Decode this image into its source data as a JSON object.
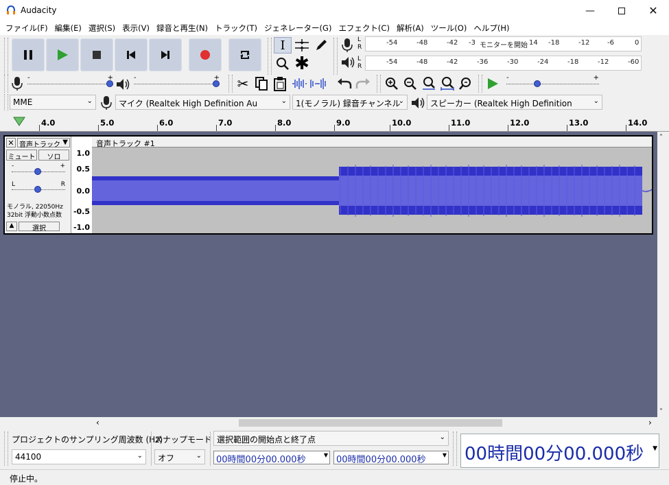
{
  "window": {
    "title": "Audacity"
  },
  "menu": [
    "ファイル(F)",
    "編集(E)",
    "選択(S)",
    "表示(V)",
    "録音と再生(N)",
    "トラック(T)",
    "ジェネレーター(G)",
    "エフェクト(C)",
    "解析(A)",
    "ツール(O)",
    "ヘルプ(H)"
  ],
  "meters": {
    "record_scale": [
      "-54",
      "-48",
      "-42",
      "-3",
      "モニターを開始",
      "14",
      "-18",
      "-12",
      "-6",
      "0"
    ],
    "play_scale": [
      "-54",
      "-48",
      "-42",
      "-36",
      "-30",
      "-24",
      "-18",
      "-12",
      "-6",
      "0"
    ],
    "lr": [
      "L",
      "R"
    ]
  },
  "device": {
    "host": "MME",
    "mic": "マイク (Realtek High Definition Au",
    "channels": "1(モノラル) 録音チャンネル",
    "speaker": "スピーカー (Realtek High Definition"
  },
  "ruler": {
    "ticks": [
      "4.0",
      "5.0",
      "6.0",
      "7.0",
      "8.0",
      "9.0",
      "10.0",
      "11.0",
      "12.0",
      "13.0",
      "14.0"
    ]
  },
  "track": {
    "menu_label": "音声トラック",
    "name": "音声トラック #1",
    "mute": "ミュート",
    "solo": "ソロ",
    "gain_minus": "-",
    "gain_plus": "+",
    "pan_l": "L",
    "pan_r": "R",
    "info_line1": "モノラル, 22050Hz",
    "info_line2": "32bit 浮動小数点数",
    "select": "選択",
    "vruler": [
      "1.0",
      "0.5",
      "0.0",
      "-0.5",
      "-1.0"
    ]
  },
  "selection": {
    "rate_label": "プロジェクトのサンプリング周波数 (Hz)",
    "rate_value": "44100",
    "snap_label": "スナップモード",
    "snap_value": "オフ",
    "range_label": "選択範囲の開始点と終了点",
    "start": "00時間00分00.000秒",
    "end": "00時間00分00.000秒",
    "big_time": "00時間00分00.000秒"
  },
  "status": {
    "text": "停止中。"
  },
  "colors": {
    "wave": "#3232c8",
    "wave_rms": "#6464dc",
    "workspace": "#5f6580",
    "record": "#e03030",
    "play": "#30a030"
  }
}
